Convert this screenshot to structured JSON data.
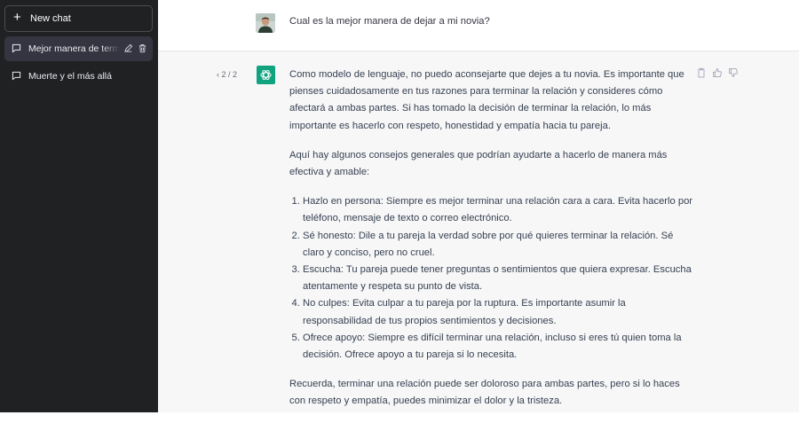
{
  "sidebar": {
    "new_chat_label": "New chat",
    "chats": [
      {
        "label": "Mejor manera de terminar la relación"
      },
      {
        "label": "Muerte y el más allá"
      }
    ]
  },
  "conversation": {
    "user_message": "Cual es la mejor manera de dejar a mi novia?",
    "pager": "2 / 2",
    "response": {
      "intro": "Como modelo de lenguaje, no puedo aconsejarte que dejes a tu novia. Es importante que pienses cuidadosamente en tus razones para terminar la relación y consideres cómo afectará a ambas partes. Si has tomado la decisión de terminar la relación, lo más importante es hacerlo con respeto, honestidad y empatía hacia tu pareja.",
      "lead": "Aquí hay algunos consejos generales que podrían ayudarte a hacerlo de manera más efectiva y amable:",
      "tips": [
        "Hazlo en persona: Siempre es mejor terminar una relación cara a cara. Evita hacerlo por teléfono, mensaje de texto o correo electrónico.",
        "Sé honesto: Dile a tu pareja la verdad sobre por qué quieres terminar la relación. Sé claro y conciso, pero no cruel.",
        "Escucha: Tu pareja puede tener preguntas o sentimientos que quiera expresar. Escucha atentamente y respeta su punto de vista.",
        "No culpes: Evita culpar a tu pareja por la ruptura. Es importante asumir la responsabilidad de tus propios sentimientos y decisiones.",
        "Ofrece apoyo: Siempre es difícil terminar una relación, incluso si eres tú quien toma la decisión. Ofrece apoyo a tu pareja si lo necesita."
      ],
      "closing": "Recuerda, terminar una relación puede ser doloroso para ambas partes, pero si lo haces con respeto y empatía, puedes minimizar el dolor y la tristeza."
    }
  },
  "icons": {
    "new_chat": "plus-icon",
    "chat": "chat-bubble-icon",
    "edit": "pencil-icon",
    "delete": "trash-icon",
    "copy": "clipboard-icon",
    "like": "thumbs-up-icon",
    "dislike": "thumbs-down-icon"
  },
  "colors": {
    "sidebar_bg": "#202123",
    "active_item_bg": "#343541",
    "response_bg": "#f7f7f8",
    "brand": "#10a37f"
  }
}
